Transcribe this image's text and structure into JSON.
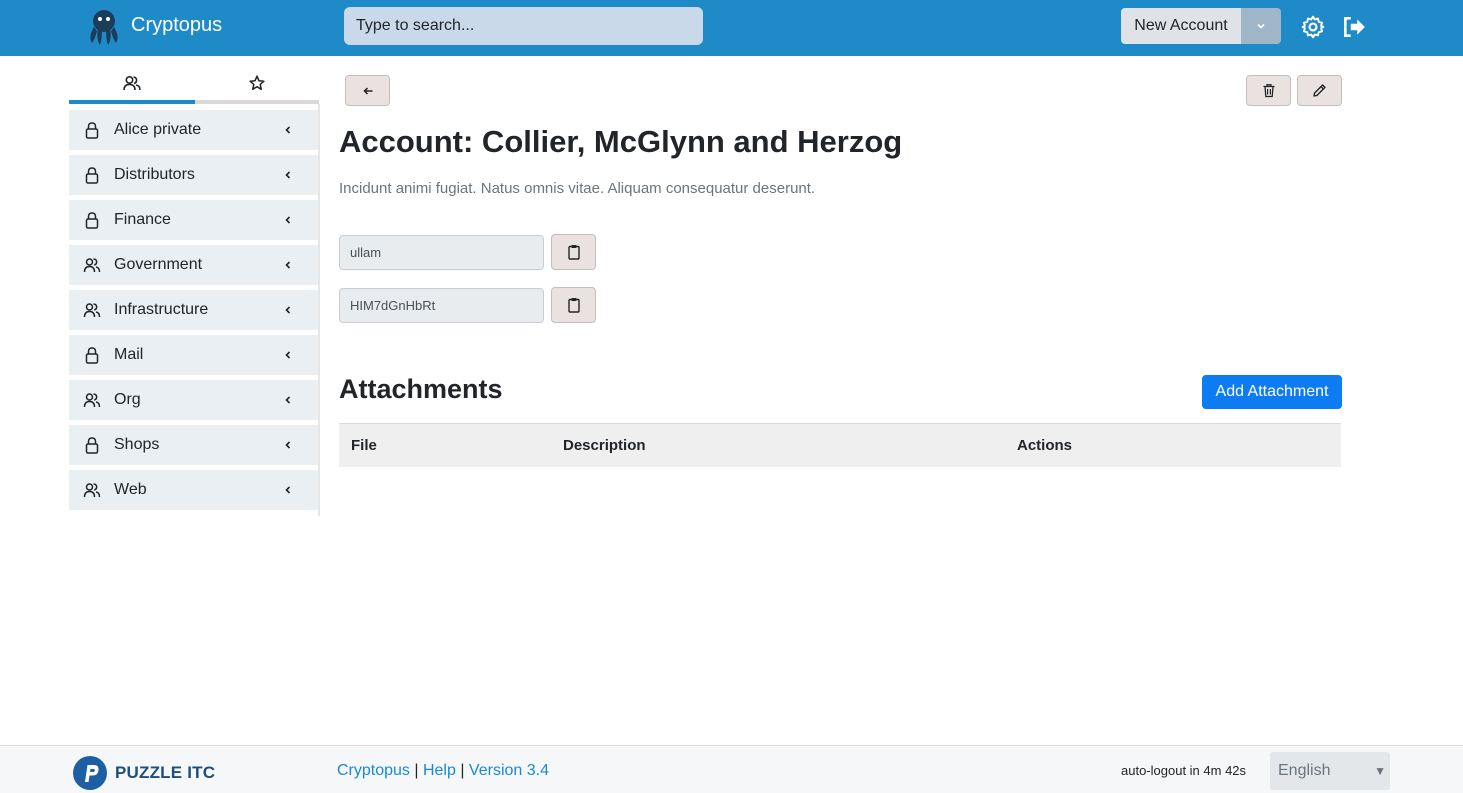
{
  "header": {
    "app_title": "Cryptopus",
    "search_placeholder": "Type to search...",
    "new_account_label": "New Account"
  },
  "sidebar": {
    "tabs": [
      {
        "icon": "people-icon",
        "active": true
      },
      {
        "icon": "star-icon",
        "active": false
      }
    ],
    "items": [
      {
        "label": "Alice private",
        "icon": "lock-icon"
      },
      {
        "label": "Distributors",
        "icon": "lock-icon"
      },
      {
        "label": "Finance",
        "icon": "lock-icon"
      },
      {
        "label": "Government",
        "icon": "people-icon"
      },
      {
        "label": "Infrastructure",
        "icon": "people-icon"
      },
      {
        "label": "Mail",
        "icon": "lock-icon"
      },
      {
        "label": "Org",
        "icon": "people-icon"
      },
      {
        "label": "Shops",
        "icon": "lock-icon"
      },
      {
        "label": "Web",
        "icon": "people-icon"
      }
    ]
  },
  "main": {
    "title": "Account: Collier, McGlynn and Herzog",
    "description": "Incidunt animi fugiat. Natus omnis vitae. Aliquam consequatur deserunt.",
    "username_value": "ullam",
    "password_value": "HIM7dGnHbRt",
    "attachments_title": "Attachments",
    "add_attachment_label": "Add Attachment",
    "table_headers": [
      "File",
      "Description",
      "Actions"
    ]
  },
  "footer": {
    "brand": "PUZZLE ITC",
    "link_cryptopus": "Cryptopus",
    "sep1": " | ",
    "link_help": "Help",
    "sep2": " | ",
    "link_version": "Version 3.4",
    "autologout": "auto-logout in 4m 42s",
    "language": "English"
  },
  "colors": {
    "header_bg": "#1e8bc8",
    "primary_button": "#0d7cf2",
    "sidebar_item_bg": "#eaeff3",
    "active_tab_bar": "#1e8bc8"
  }
}
